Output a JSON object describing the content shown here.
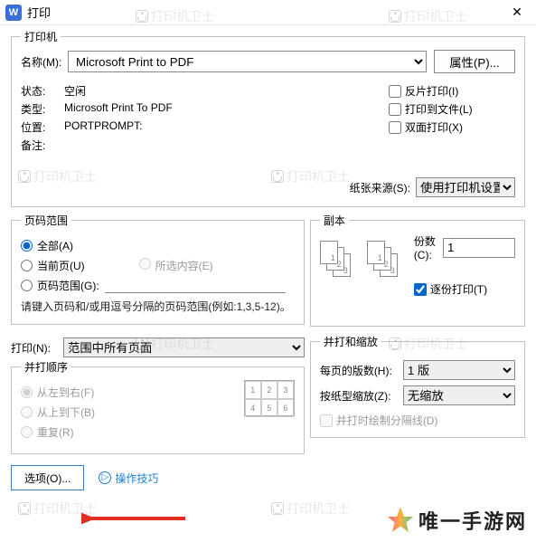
{
  "title": "打印",
  "printer_group": {
    "legend": "打印机",
    "name_label": "名称(M):",
    "name_value": "Microsoft Print to PDF",
    "properties_btn": "属性(P)...",
    "status_label": "状态:",
    "status_value": "空闲",
    "type_label": "类型:",
    "type_value": "Microsoft Print To PDF",
    "where_label": "位置:",
    "where_value": "PORTPROMPT:",
    "comment_label": "备注:",
    "comment_value": "",
    "reverse_print": "反片打印(I)",
    "print_to_file": "打印到文件(L)",
    "duplex": "双面打印(X)",
    "paper_source_label": "纸张来源(S):",
    "paper_source_value": "使用打印机设置"
  },
  "range_group": {
    "legend": "页码范围",
    "all": "全部(A)",
    "current": "当前页(U)",
    "selection": "所选内容(E)",
    "pages_label": "页码范围(G):",
    "hint": "请键入页码和/或用逗号分隔的页码范围(例如:1,3,5-12)。"
  },
  "copies_group": {
    "legend": "副本",
    "copies_label": "份数(C):",
    "copies_value": "1",
    "collate": "逐份打印(T)"
  },
  "print_what": {
    "label": "打印(N):",
    "value": "范围中所有页面"
  },
  "order_group": {
    "legend": "并打顺序",
    "lr": "从左到右(F)",
    "tb": "从上到下(B)",
    "repeat": "重复(R)"
  },
  "scale_group": {
    "legend": "并打和缩放",
    "pps_label": "每页的版数(H):",
    "pps_value": "1 版",
    "scale_label": "按纸型缩放(Z):",
    "scale_value": "无缩放",
    "draw_lines": "并打时绘制分隔线(D)"
  },
  "options_btn": "选项(O)...",
  "tips": "操作技巧",
  "watermark_text": "打印机卫士",
  "brand_text": "唯一手游网"
}
